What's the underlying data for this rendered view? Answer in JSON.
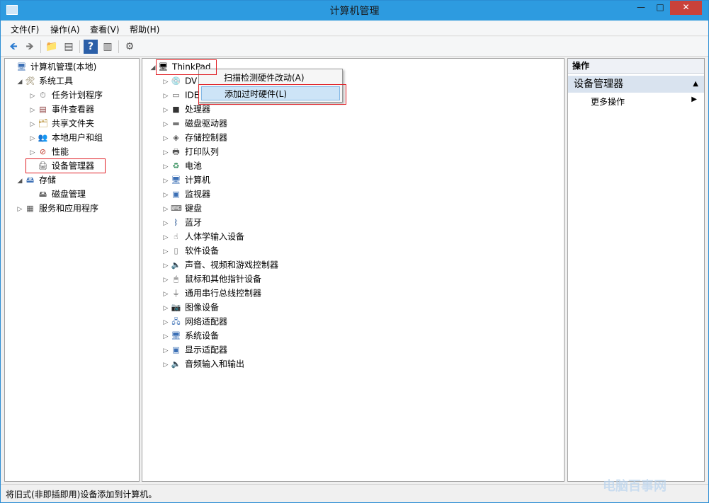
{
  "window": {
    "title": "计算机管理",
    "min": "—",
    "max": "□",
    "close": "✕"
  },
  "menu": [
    "文件(F)",
    "操作(A)",
    "查看(V)",
    "帮助(H)"
  ],
  "toolbar": {
    "back": "🡸",
    "forward": "🡺",
    "up": "📁",
    "props": "▤",
    "help": "?",
    "view": "▥",
    "run": "⚙"
  },
  "left_tree": [
    {
      "label": "计算机管理(本地)",
      "level": 0,
      "exp": "",
      "icon": "🖥",
      "color": "#3b6fb5"
    },
    {
      "label": "系统工具",
      "level": 1,
      "exp": "◢",
      "icon": "🛠",
      "color": "#7a6a40"
    },
    {
      "label": "任务计划程序",
      "level": 2,
      "exp": "▷",
      "icon": "⏱",
      "color": "#6a6a6a"
    },
    {
      "label": "事件查看器",
      "level": 2,
      "exp": "▷",
      "icon": "▤",
      "color": "#8a3a3a"
    },
    {
      "label": "共享文件夹",
      "level": 2,
      "exp": "▷",
      "icon": "🗂",
      "color": "#b58a2a"
    },
    {
      "label": "本地用户和组",
      "level": 2,
      "exp": "▷",
      "icon": "👥",
      "color": "#3b6fb5"
    },
    {
      "label": "性能",
      "level": 2,
      "exp": "▷",
      "icon": "⊘",
      "color": "#c0392b"
    },
    {
      "label": "设备管理器",
      "level": 2,
      "exp": "",
      "icon": "🖨",
      "color": "#555"
    },
    {
      "label": "存储",
      "level": 1,
      "exp": "◢",
      "icon": "🖴",
      "color": "#3b6fb5"
    },
    {
      "label": "磁盘管理",
      "level": 2,
      "exp": "",
      "icon": "🖴",
      "color": "#555"
    },
    {
      "label": "服务和应用程序",
      "level": 1,
      "exp": "▷",
      "icon": "▦",
      "color": "#555"
    }
  ],
  "device_tree": {
    "root": {
      "label": "ThinkPad",
      "icon": "🖥"
    },
    "items": [
      {
        "label": "DV",
        "icon": "💿",
        "color": "#666"
      },
      {
        "label": "IDE",
        "icon": "▭",
        "color": "#666"
      },
      {
        "label": "处理器",
        "icon": "■",
        "color": "#333"
      },
      {
        "label": "磁盘驱动器",
        "icon": "▬",
        "color": "#777"
      },
      {
        "label": "存储控制器",
        "icon": "◈",
        "color": "#555"
      },
      {
        "label": "打印队列",
        "icon": "🖶",
        "color": "#555"
      },
      {
        "label": "电池",
        "icon": "♻",
        "color": "#2e8b57"
      },
      {
        "label": "计算机",
        "icon": "🖥",
        "color": "#3b6fb5"
      },
      {
        "label": "监视器",
        "icon": "▣",
        "color": "#3b6fb5"
      },
      {
        "label": "键盘",
        "icon": "⌨",
        "color": "#555"
      },
      {
        "label": "蓝牙",
        "icon": "ᛒ",
        "color": "#1f4f8f"
      },
      {
        "label": "人体学输入设备",
        "icon": "☝",
        "color": "#555"
      },
      {
        "label": "软件设备",
        "icon": "▯",
        "color": "#777"
      },
      {
        "label": "声音、视频和游戏控制器",
        "icon": "🔈",
        "color": "#555"
      },
      {
        "label": "鼠标和其他指针设备",
        "icon": "🖱",
        "color": "#555"
      },
      {
        "label": "通用串行总线控制器",
        "icon": "⏚",
        "color": "#555"
      },
      {
        "label": "图像设备",
        "icon": "📷",
        "color": "#555"
      },
      {
        "label": "网络适配器",
        "icon": "🖧",
        "color": "#3b6fb5"
      },
      {
        "label": "系统设备",
        "icon": "🖥",
        "color": "#3b6fb5"
      },
      {
        "label": "显示适配器",
        "icon": "▣",
        "color": "#3b6fb5"
      },
      {
        "label": "音频输入和输出",
        "icon": "🔈",
        "color": "#555"
      }
    ]
  },
  "context_menu": {
    "scan": "扫描检测硬件改动(A)",
    "add": "添加过时硬件(L)"
  },
  "actions": {
    "header": "操作",
    "section": "设备管理器",
    "section_arrow": "▲",
    "more": "更多操作",
    "more_arrow": "▶"
  },
  "status": "将旧式(非即插即用)设备添加到计算机。",
  "watermark": "电脑百事网"
}
